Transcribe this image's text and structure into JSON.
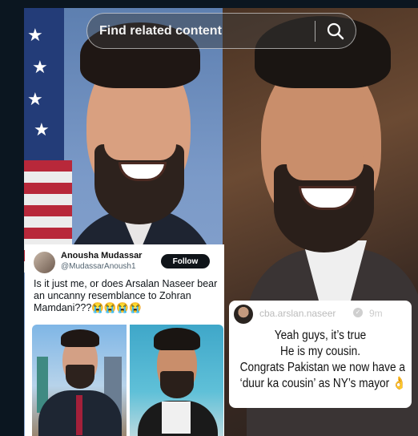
{
  "search": {
    "placeholder": "Find related content",
    "icon": "search-icon"
  },
  "tweet": {
    "name": "Anousha Mudassar",
    "handle": "@MudassarAnoush1",
    "follow_label": "Follow",
    "text": "Is it just me, or does Arsalan Naseer bear an uncanny resemblance to Zohran Mamdani???😭😭😭😭"
  },
  "story": {
    "username": "cba.arslan.naseer",
    "time": "9m",
    "lines": [
      "Yeah guys, it’s true",
      "He is my cousin.",
      "Congrats Pakistan we now have a",
      "‘duur ka cousin’ as NY’s mayor 👌"
    ]
  },
  "colors": {
    "follow_bg": "#0f1419",
    "flag_red": "#b8283a",
    "flag_blue": "#233c78"
  }
}
